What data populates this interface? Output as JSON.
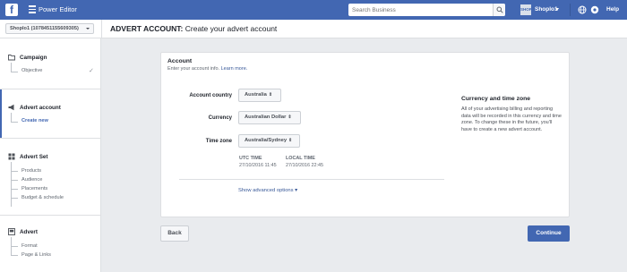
{
  "topbar": {
    "logo": "f",
    "app_title": "Power Editor",
    "search_placeholder": "Search Business",
    "account_initials": "SHOP",
    "account_name": "Shoplo1",
    "help": "Help"
  },
  "header": {
    "account_select": "Shoplo1 (1078451155609305)",
    "title_bold": "ADVERT ACCOUNT:",
    "title_rest": " Create your advert account"
  },
  "sidebar": {
    "campaign": {
      "label": "Campaign",
      "items": [
        "Objective"
      ]
    },
    "advert_account": {
      "label": "Advert account",
      "items": [
        "Create new"
      ]
    },
    "advert_set": {
      "label": "Advert Set",
      "items": [
        "Products",
        "Audience",
        "Placements",
        "Budget & schedule"
      ]
    },
    "advert": {
      "label": "Advert",
      "items": [
        "Format",
        "Page & Links"
      ]
    }
  },
  "card": {
    "title": "Account",
    "subtitle": "Enter your account info. ",
    "learn_more": "Learn more.",
    "country_label": "Account country",
    "country_value": "Australia",
    "currency_label": "Currency",
    "currency_value": "Australian Dollar",
    "timezone_label": "Time zone",
    "timezone_value": "Australia/Sydney",
    "utc_head": "UTC TIME",
    "utc_value": "27/10/2016 11:45",
    "local_head": "LOCAL TIME",
    "local_value": "27/10/2016 22:45",
    "advanced": "Show advanced options",
    "aside_title": "Currency and time zone",
    "aside_text": "All of your advertising billing and reporting data will be recorded in this currency and time zone. To change these in the future, you'll have to create a new advert account."
  },
  "buttons": {
    "back": "Back",
    "continue": "Continue"
  },
  "colors": {
    "brand": "#4267b2",
    "link": "#385898"
  }
}
